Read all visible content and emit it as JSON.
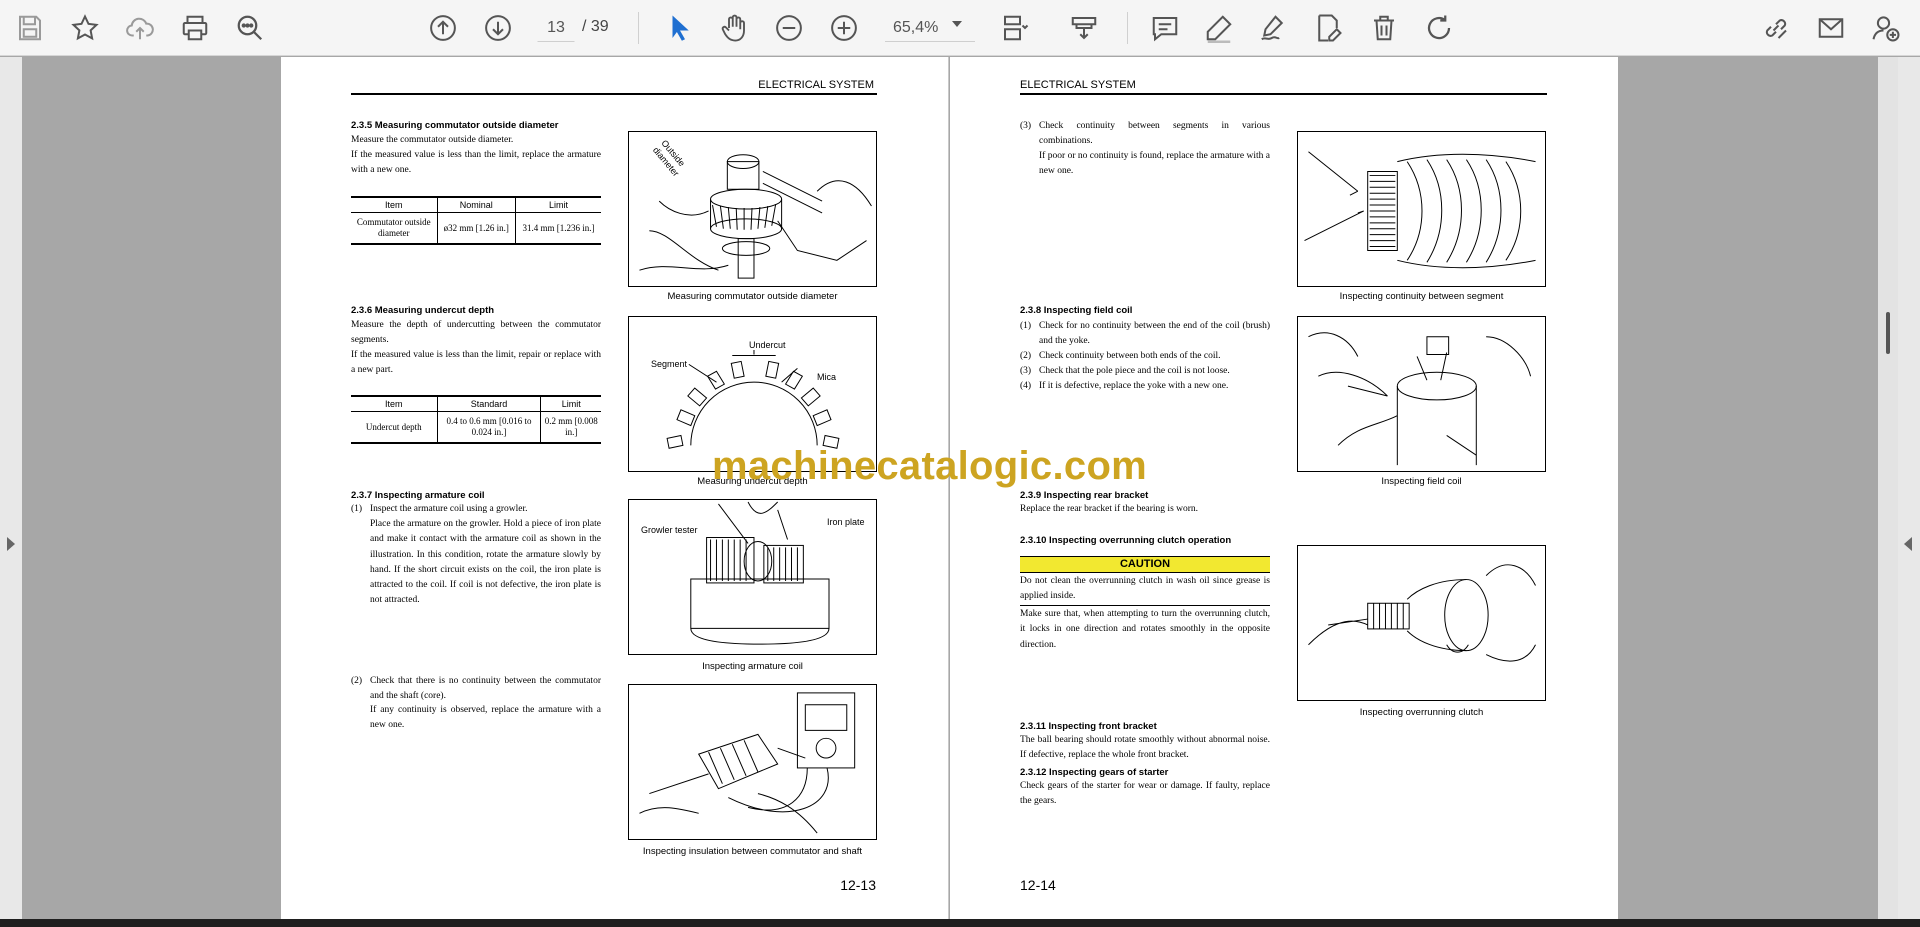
{
  "toolbar": {
    "page_current": "13",
    "page_total": "/ 39",
    "zoom": "65,4%",
    "icons": [
      "save-icon",
      "bookmark-star-icon",
      "cloud-upload-icon",
      "print-icon",
      "zoom-search-icon",
      "previous-page-icon",
      "next-page-icon",
      "select-cursor-icon",
      "hand-tool-icon",
      "zoom-out-icon",
      "zoom-in-icon",
      "fit-page-icon",
      "stamp-icon",
      "comment-icon",
      "highlight-pen-icon",
      "sign-icon",
      "edit-pdf-icon",
      "delete-icon",
      "redo-icon",
      "share-link-icon",
      "email-icon",
      "add-user-icon"
    ]
  },
  "left_page": {
    "header": "ELECTRICAL SYSTEM",
    "page_number": "12-13",
    "s235": {
      "title": "2.3.5    Measuring commutator outside diameter",
      "p1": "Measure the commutator outside diameter.",
      "p2": "If the measured value is less than the limit, replace the armature with a new one.",
      "table": {
        "headers": [
          "Item",
          "Nominal",
          "Limit"
        ],
        "rows": [
          [
            "Commutator outside diameter",
            "ø32 mm [1.26 in.]",
            "31.4 mm [1.236 in.]"
          ]
        ]
      },
      "fig_label": "Outside diameter",
      "caption": "Measuring commutator outside diameter"
    },
    "s236": {
      "title": "2.3.6    Measuring undercut depth",
      "p1": "Measure the depth of undercutting between the commutator segments.",
      "p2": "If the measured value is less than the limit, repair or replace with a new part.",
      "table": {
        "headers": [
          "Item",
          "Standard",
          "Limit"
        ],
        "rows": [
          [
            "Undercut depth",
            "0.4 to 0.6 mm [0.016 to 0.024 in.]",
            "0.2 mm [0.008 in.]"
          ]
        ]
      },
      "fig_labels": {
        "undercut": "Undercut",
        "segment": "Segment",
        "mica": "Mica"
      },
      "caption": "Measuring undercut depth"
    },
    "s237": {
      "title": "2.3.7    Inspecting armature coil",
      "n1": "(1)",
      "p1a": "Inspect the armature coil using a growler.",
      "p1b": "Place the armature on the growler. Hold a piece of iron plate and make it contact with the armature coil as shown in the illustration. In this condition, rotate the armature slowly by hand. If the short circuit exists on the coil, the iron plate is attracted to the coil. If coil is not defective, the iron plate is not attracted.",
      "fig_labels": {
        "growler": "Growler tester",
        "iron": "Iron plate"
      },
      "caption1": "Inspecting armature coil",
      "n2": "(2)",
      "p2a": "Check that there is no continuity between the commutator and the shaft (core).",
      "p2b": "If any continuity is observed, replace the armature with a new one.",
      "caption2": "Inspecting insulation between commutator and shaft"
    }
  },
  "right_page": {
    "header": "ELECTRICAL SYSTEM",
    "page_number": "12-14",
    "cont": {
      "n3": "(3)",
      "p3a": "Check continuity between segments in various combinations.",
      "p3b": "If poor or no continuity is found, replace the armature with a new one.",
      "caption": "Inspecting continuity between segment"
    },
    "s238": {
      "title": "2.3.8    Inspecting field coil",
      "items": [
        {
          "n": "(1)",
          "t": "Check for no continuity between the end of the coil (brush) and the yoke."
        },
        {
          "n": "(2)",
          "t": "Check continuity between both ends of the coil."
        },
        {
          "n": "(3)",
          "t": "Check that the pole piece  and the coil is not loose."
        },
        {
          "n": "(4)",
          "t": "If it is defective, replace the yoke with a new one."
        }
      ],
      "caption": "Inspecting field coil"
    },
    "s239": {
      "title": "2.3.9    Inspecting rear bracket",
      "p": "Replace the rear bracket if the bearing is worn."
    },
    "s2310": {
      "title": "2.3.10  Inspecting overrunning clutch operation",
      "caution": "CAUTION",
      "caution_text": "Do not clean the overrunning clutch in wash oil since grease is applied inside.",
      "p": "Make sure that, when attempting to turn the overrunning clutch, it locks in one direction and rotates smoothly in the opposite direction.",
      "caption": "Inspecting overrunning clutch"
    },
    "s2311": {
      "title": "2.3.11  Inspecting front bracket",
      "p": "The ball bearing should rotate smoothly without abnormal noise. If defective, replace the whole front bracket."
    },
    "s2312": {
      "title": "2.3.12  Inspecting gears of starter",
      "p": "Check gears of the starter for wear or damage. If faulty, replace the gears."
    }
  },
  "watermark": "machinecatalogic.com"
}
